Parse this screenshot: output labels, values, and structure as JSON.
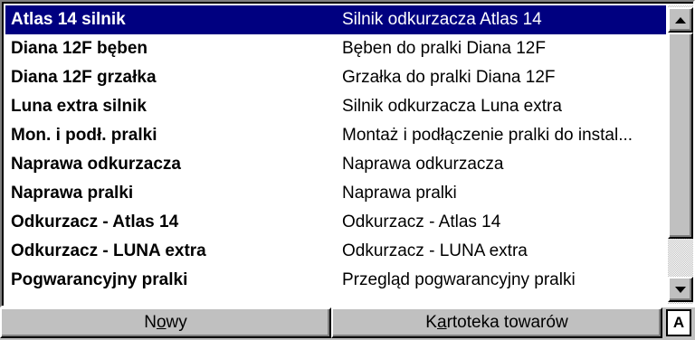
{
  "list": {
    "rows": [
      {
        "name": "Atlas 14 silnik",
        "desc": "Silnik odkurzacza Atlas 14",
        "selected": true
      },
      {
        "name": "Diana 12F bęben",
        "desc": "Bęben do pralki Diana 12F",
        "selected": false
      },
      {
        "name": "Diana 12F grzałka",
        "desc": "Grzałka do pralki Diana 12F",
        "selected": false
      },
      {
        "name": "Luna extra silnik",
        "desc": "Silnik odkurzacza Luna extra",
        "selected": false
      },
      {
        "name": "Mon. i podł. pralki",
        "desc": "Montaż i podłączenie pralki do instal...",
        "selected": false
      },
      {
        "name": "Naprawa odkurzacza",
        "desc": "Naprawa odkurzacza",
        "selected": false
      },
      {
        "name": "Naprawa pralki",
        "desc": "Naprawa pralki",
        "selected": false
      },
      {
        "name": "Odkurzacz - Atlas 14",
        "desc": "Odkurzacz - Atlas 14",
        "selected": false
      },
      {
        "name": "Odkurzacz - LUNA extra",
        "desc": "Odkurzacz - LUNA extra",
        "selected": false
      },
      {
        "name": "Pogwarancyjny pralki",
        "desc": "Przegląd pogwarancyjny pralki",
        "selected": false
      }
    ]
  },
  "buttons": {
    "new_pre": "N",
    "new_mn": "o",
    "new_post": "wy",
    "catalog_pre": "K",
    "catalog_mn": "a",
    "catalog_post": "rtoteka towarów",
    "mode_label": "A"
  },
  "colors": {
    "selection": "#000080",
    "face": "#c0c0c0"
  },
  "icons": {
    "scroll_up": "triangle-up",
    "scroll_down": "triangle-down"
  }
}
